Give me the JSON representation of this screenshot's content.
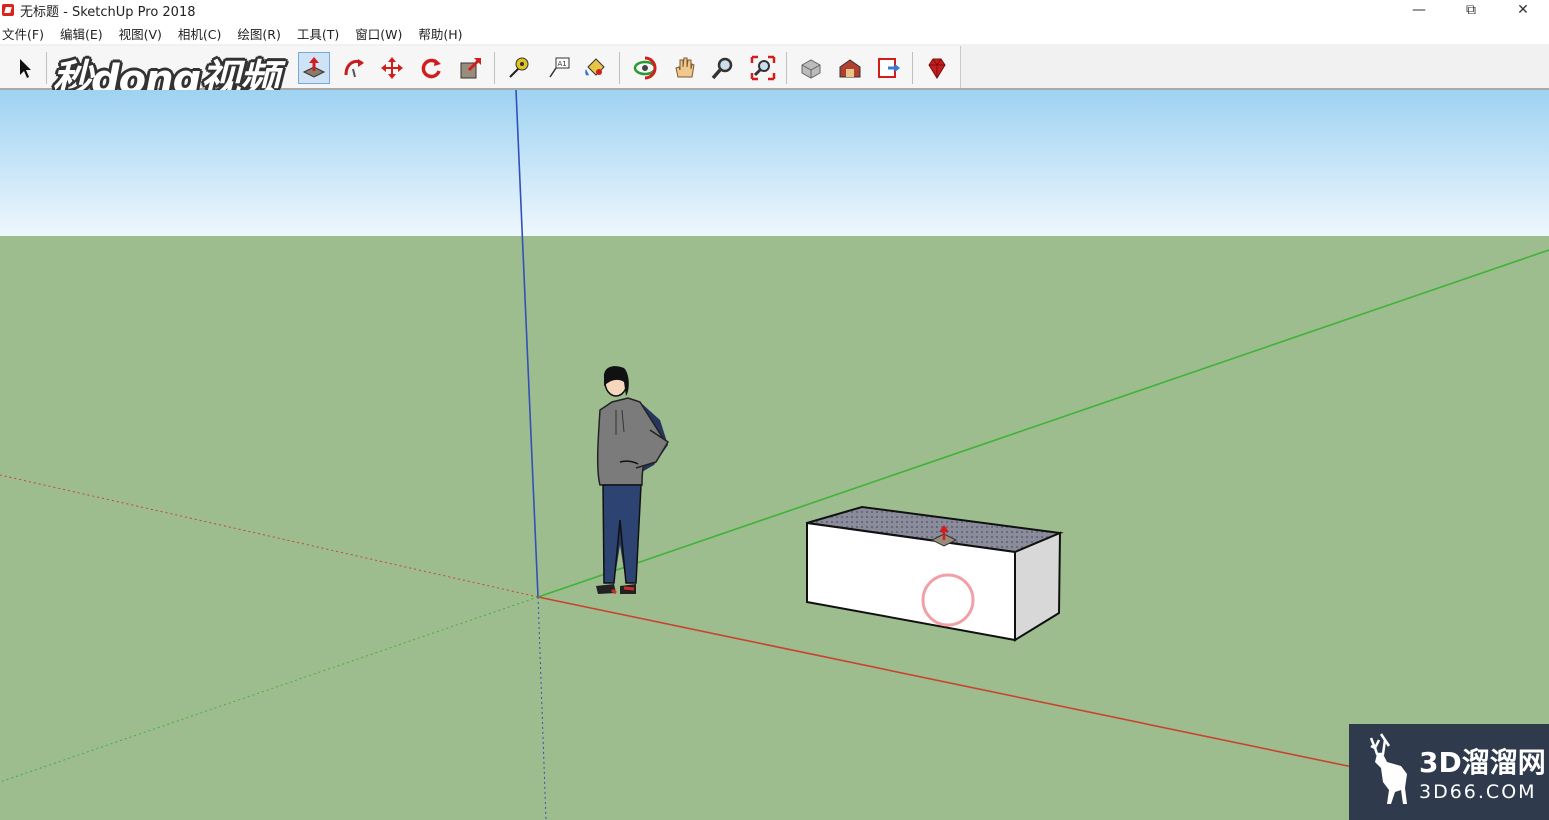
{
  "window": {
    "title": "无标题 - SketchUp Pro 2018",
    "controls": [
      "—",
      "⧉",
      "✕"
    ]
  },
  "menu": [
    "文件(F)",
    "编辑(E)",
    "视图(V)",
    "相机(C)",
    "绘图(R)",
    "工具(T)",
    "窗口(W)",
    "帮助(H)"
  ],
  "toolbar": {
    "active_tool": "push-pull",
    "tools": [
      "select",
      "push-pull",
      "follow-me",
      "move",
      "rotate",
      "scale",
      "tape-measure",
      "text",
      "paint-bucket",
      "orbit",
      "pan",
      "zoom",
      "zoom-extents",
      "components",
      "warehouse",
      "send-to-layout",
      "extension-warehouse"
    ]
  },
  "overlay_logo": "秒dong视频",
  "watermark": {
    "brand": "3D溜溜网",
    "domain": "3D66.COM"
  },
  "colors": {
    "sky_top": "#9fd2f2",
    "sky_bottom": "#eef7fd",
    "ground": "#9dbd8f",
    "axis_red": "#c8442f",
    "axis_green": "#3fb338",
    "axis_blue": "#3350b8",
    "toolbar_bg": "#f1f1f1",
    "watermark_bg": "#2f3b4d"
  }
}
